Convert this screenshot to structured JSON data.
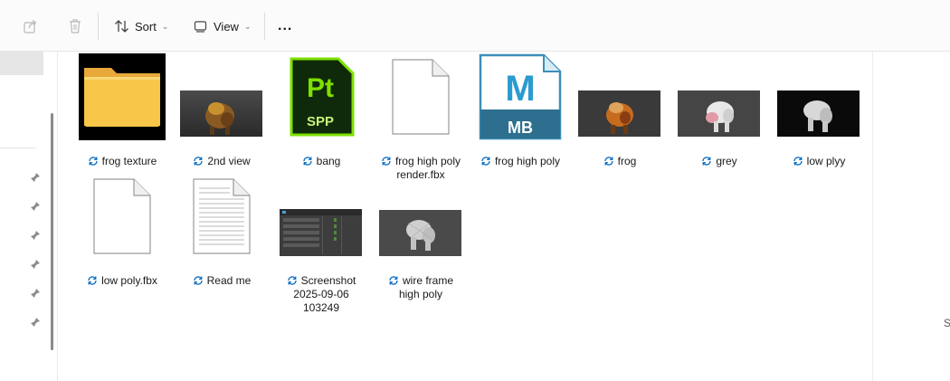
{
  "toolbar": {
    "sort_label": "Sort",
    "view_label": "View",
    "more_label": "..."
  },
  "files": [
    {
      "name": "frog texture",
      "type": "folder"
    },
    {
      "name": "2nd view",
      "type": "image-render-orange"
    },
    {
      "name": "bang",
      "type": "substance-painter",
      "badge_top": "Pt",
      "badge_bottom": "SPP"
    },
    {
      "name": "frog high poly\nrender.fbx",
      "type": "blank-doc"
    },
    {
      "name": "frog high poly",
      "type": "mudbox",
      "badge_top": "M",
      "badge_bottom": "MB"
    },
    {
      "name": "frog",
      "type": "image-render-orange"
    },
    {
      "name": "grey",
      "type": "image-render-grey"
    },
    {
      "name": "low plyy",
      "type": "image-render-white"
    },
    {
      "name": "low poly.fbx",
      "type": "blank-doc"
    },
    {
      "name": "Read me",
      "type": "text-doc"
    },
    {
      "name": "Screenshot\n2025-09-06\n103249",
      "type": "screenshot"
    },
    {
      "name": "wire frame\nhigh poly",
      "type": "image-render-wire"
    }
  ],
  "edge_text": "S",
  "colors": {
    "accent": "#0067c0",
    "folder": "#f8c648",
    "painter_green": "#7ee000",
    "mudbox_blue": "#3b8fb8"
  }
}
